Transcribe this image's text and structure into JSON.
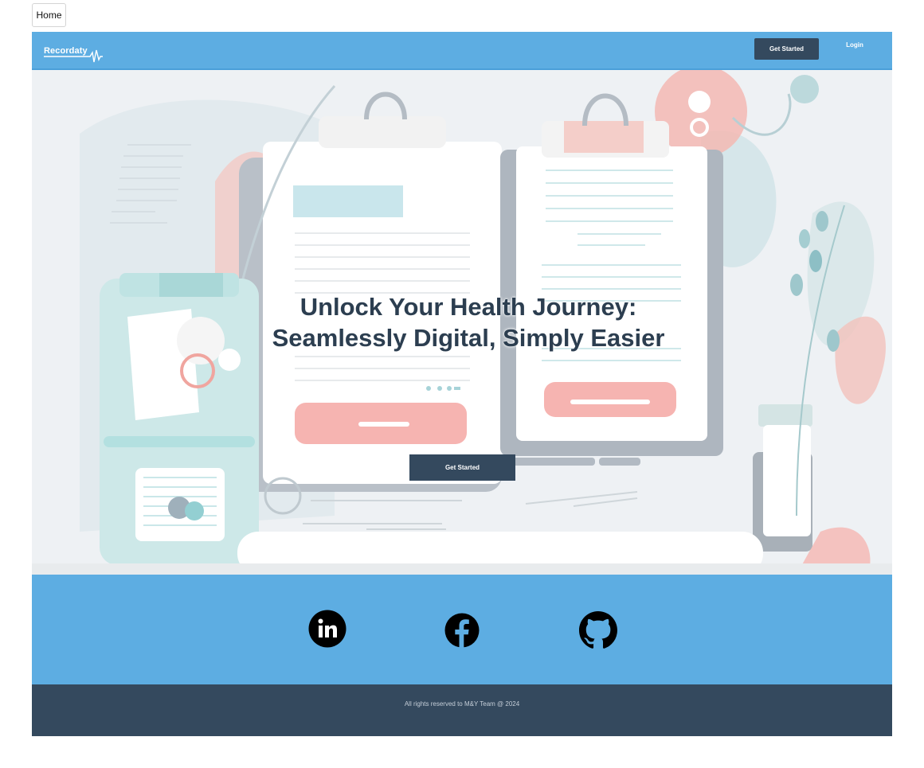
{
  "top_tab": {
    "label": "Home"
  },
  "navbar": {
    "brand": "Recordaty",
    "get_started": "Get Started",
    "login": "Login"
  },
  "hero": {
    "title_line1": "Unlock Your Health Journey:",
    "title_line2": "Seamlessly Digital, Simply Easier",
    "cta": "Get Started"
  },
  "social": {
    "links": [
      {
        "icon": "linkedin-icon"
      },
      {
        "icon": "facebook-icon"
      },
      {
        "icon": "github-icon"
      }
    ]
  },
  "footer": {
    "text": "All rights reserved to M&Y Team @ 2024"
  },
  "colors": {
    "primary": "#5dade2",
    "dark": "#34495e",
    "hero_bg": "#eef1f4"
  }
}
